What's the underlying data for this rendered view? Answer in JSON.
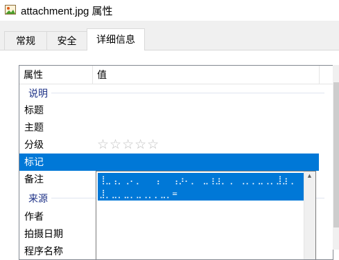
{
  "window": {
    "title": "attachment.jpg 属性",
    "icon": "image-file-icon"
  },
  "tabs": [
    {
      "label": "常规",
      "active": false
    },
    {
      "label": "安全",
      "active": false
    },
    {
      "label": "详细信息",
      "active": true
    }
  ],
  "columns": {
    "property": "属性",
    "value": "值"
  },
  "groups": {
    "description": "说明",
    "origin": "来源"
  },
  "rows": {
    "title": "标题",
    "subject": "主题",
    "rating": "分级",
    "rating_stars": "☆☆☆☆☆",
    "rating_value": 0,
    "tags": "标记",
    "comments": "备注",
    "author": "作者",
    "date_taken": "拍摄日期",
    "program_name": "程序名称"
  },
  "comments_editor": {
    "value": "⢸⣀⢠⡀⢀⠄⡀⠀⠀⢠⠀⠀⢠⡰⠄⡀⠀⣀⢰⣰⡀⢀⠀⢀⡀⡀⣀⢀⡀⣸⣰⢀⠀⣸⡀⣀⡀⣀⡀⣀⢀⡀⡀⣀⡀="
  },
  "colors": {
    "selection": "#0078d7",
    "group_text": "#1e3287"
  }
}
